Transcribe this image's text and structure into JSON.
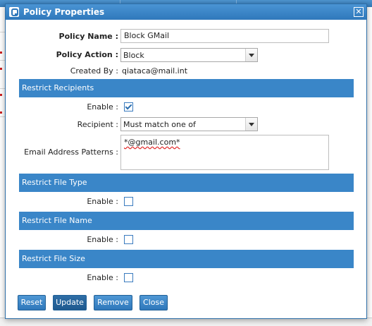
{
  "background": {
    "header_color": "#3a80c0"
  },
  "dialog": {
    "title": "Policy Properties",
    "icon": "app-logo-icon",
    "close_icon": "close-icon",
    "fields": {
      "policy_name_label": "Policy Name :",
      "policy_name_value": "Block GMail",
      "policy_action_label": "Policy Action :",
      "policy_action_value": "Block",
      "created_by_label": "Created By :",
      "created_by_value": "qiataca@mail.int"
    },
    "sections": {
      "recipients": {
        "title": "Restrict Recipients",
        "enable_label": "Enable :",
        "enabled": true,
        "recipient_label": "Recipient :",
        "recipient_value": "Must match one of",
        "patterns_label": "Email Address Patterns :",
        "patterns_value": "*@gmail.com*"
      },
      "file_type": {
        "title": "Restrict File Type",
        "enable_label": "Enable :",
        "enabled": false
      },
      "file_name": {
        "title": "Restrict File Name",
        "enable_label": "Enable :",
        "enabled": false
      },
      "file_size": {
        "title": "Restrict File Size",
        "enable_label": "Enable :",
        "enabled": false
      }
    },
    "buttons": {
      "reset": "Reset",
      "update": "Update",
      "remove": "Remove",
      "close": "Close"
    }
  },
  "colors": {
    "accent": "#3a86c8",
    "title_bar": "#2f78bb"
  }
}
